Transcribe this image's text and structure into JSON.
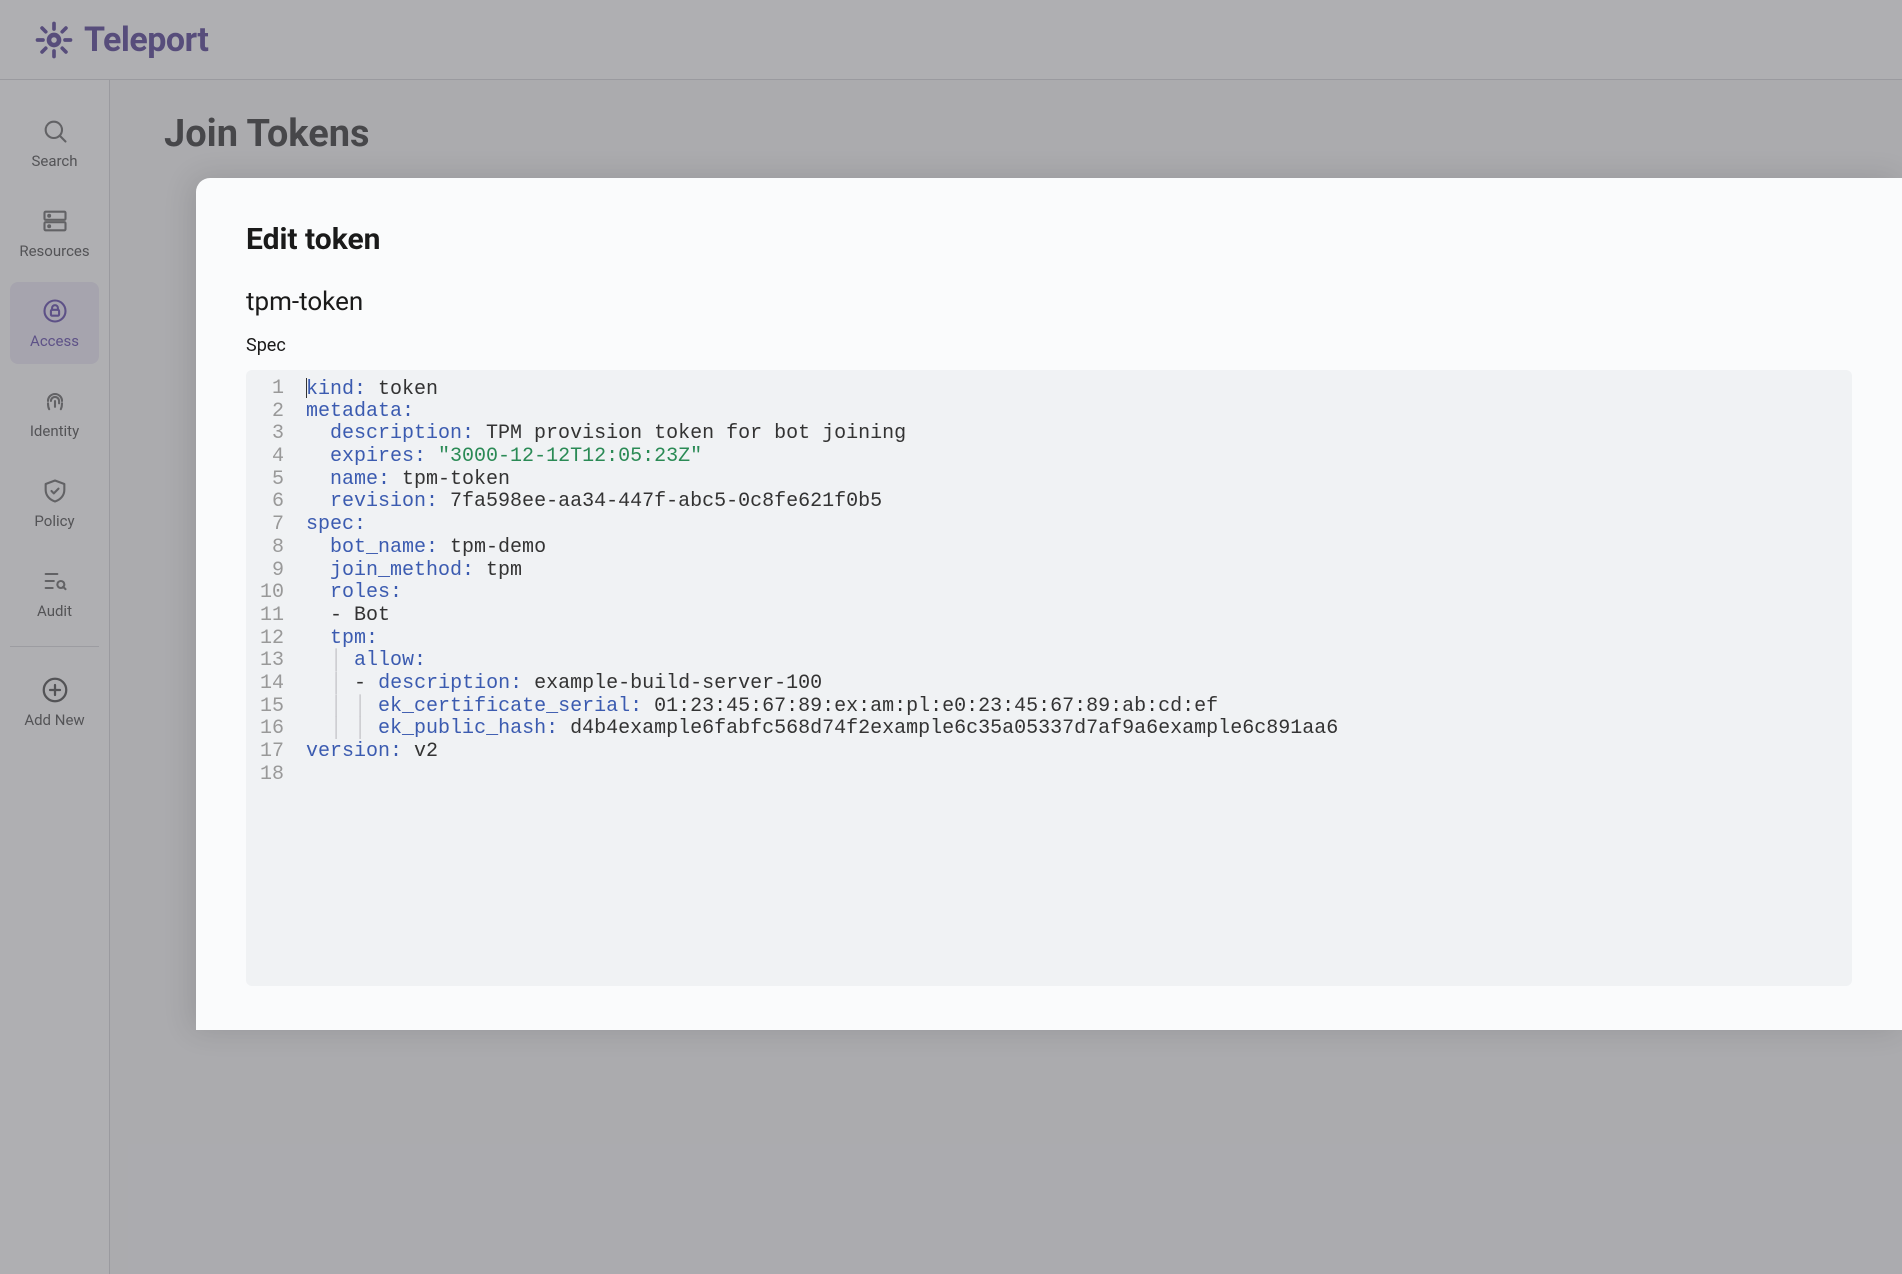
{
  "brand": {
    "name": "Teleport"
  },
  "sidebar": {
    "items": [
      {
        "label": "Search"
      },
      {
        "label": "Resources"
      },
      {
        "label": "Access"
      },
      {
        "label": "Identity"
      },
      {
        "label": "Policy"
      },
      {
        "label": "Audit"
      },
      {
        "label": "Add New"
      }
    ]
  },
  "page": {
    "title": "Join Tokens"
  },
  "panel": {
    "title": "Edit token",
    "token_name": "tpm-token",
    "spec_label": "Spec"
  },
  "editor": {
    "line_start": 1,
    "line_end": 18,
    "yaml": {
      "kind": "token",
      "metadata": {
        "description": "TPM provision token for bot joining",
        "expires": "3000-12-12T12:05:23Z",
        "name": "tpm-token",
        "revision": "7fa598ee-aa34-447f-abc5-0c8fe621f0b5"
      },
      "spec": {
        "bot_name": "tpm-demo",
        "join_method": "tpm",
        "roles": [
          "Bot"
        ],
        "tpm": {
          "allow": [
            {
              "description": "example-build-server-100",
              "ek_certificate_serial": "01:23:45:67:89:ex:am:pl:e0:23:45:67:89:ab:cd:ef",
              "ek_public_hash": "d4b4example6fabfc568d74f2example6c35a05337d7af9a6example6c891aa6"
            }
          ]
        }
      },
      "version": "v2"
    }
  }
}
